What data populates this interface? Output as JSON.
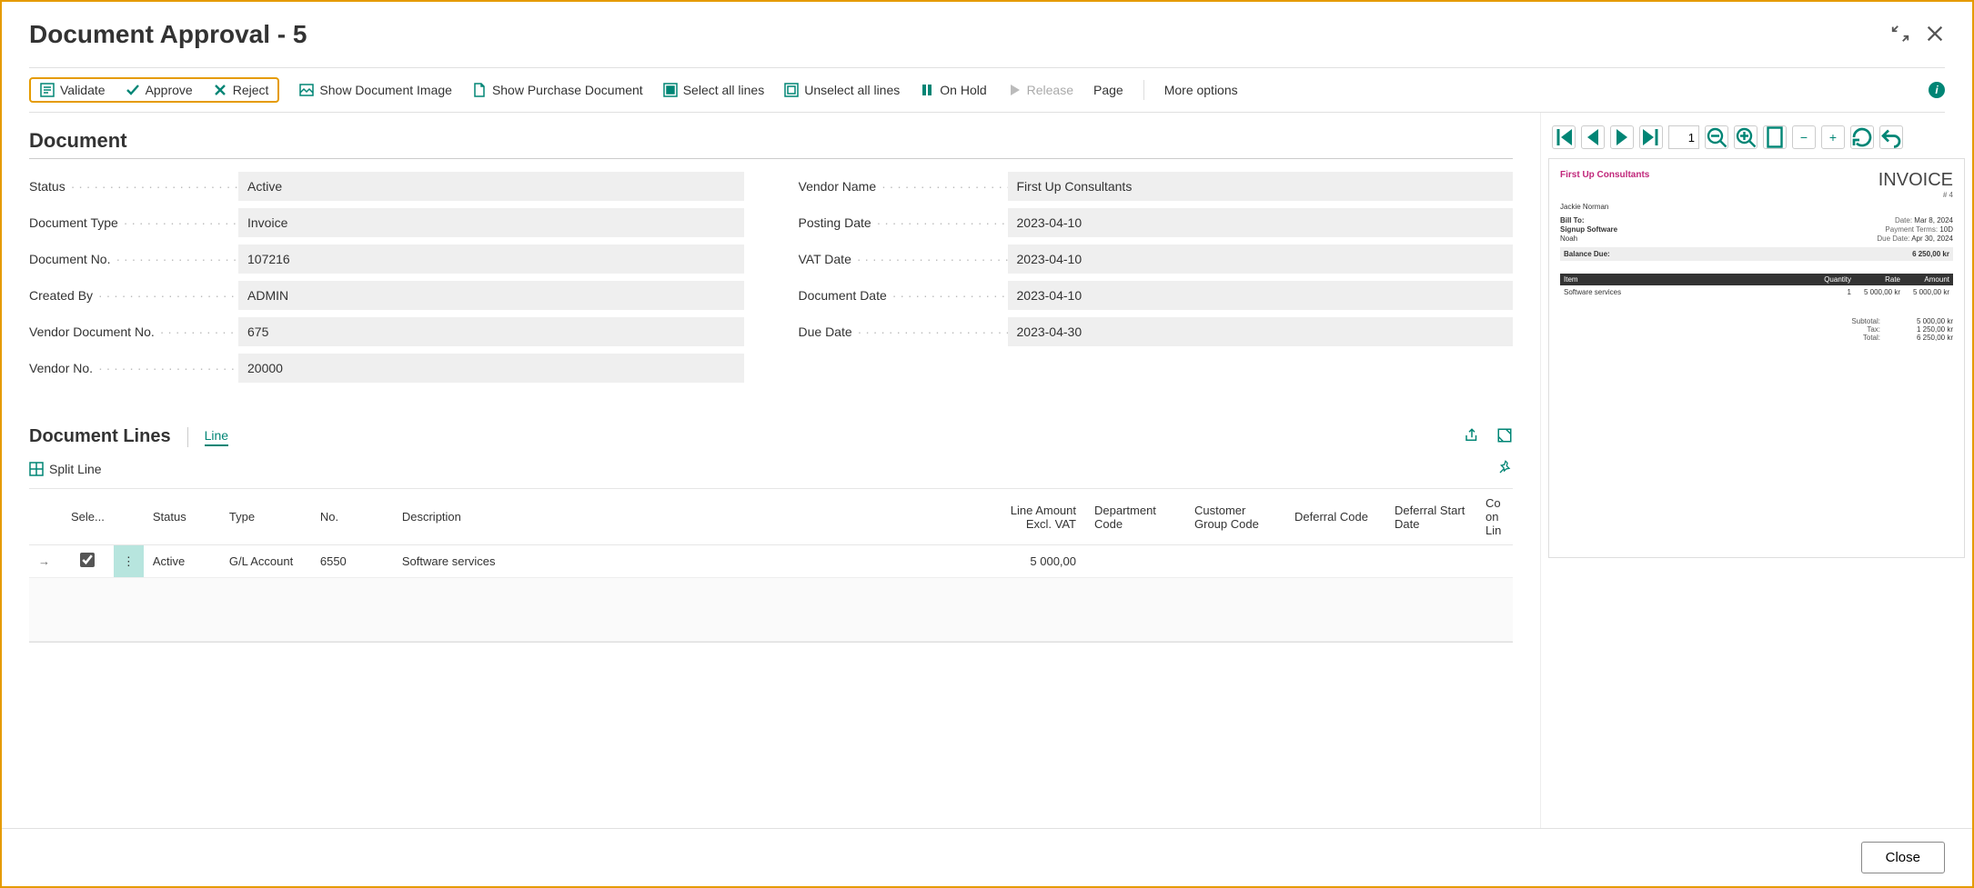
{
  "window": {
    "title": "Document Approval - 5"
  },
  "toolbar": {
    "validate": "Validate",
    "approve": "Approve",
    "reject": "Reject",
    "show_image": "Show Document Image",
    "show_purchase": "Show Purchase Document",
    "select_all": "Select all lines",
    "unselect_all": "Unselect all lines",
    "on_hold": "On Hold",
    "release": "Release",
    "page": "Page",
    "more": "More options"
  },
  "document": {
    "section_title": "Document",
    "left": [
      {
        "label": "Status",
        "value": "Active"
      },
      {
        "label": "Document Type",
        "value": "Invoice"
      },
      {
        "label": "Document No.",
        "value": "107216"
      },
      {
        "label": "Created By",
        "value": "ADMIN"
      },
      {
        "label": "Vendor Document No.",
        "value": "675"
      },
      {
        "label": "Vendor No.",
        "value": "20000"
      }
    ],
    "right": [
      {
        "label": "Vendor Name",
        "value": "First Up Consultants"
      },
      {
        "label": "Posting Date",
        "value": "2023-04-10"
      },
      {
        "label": "VAT Date",
        "value": "2023-04-10"
      },
      {
        "label": "Document Date",
        "value": "2023-04-10"
      },
      {
        "label": "Due Date",
        "value": "2023-04-30"
      }
    ]
  },
  "lines": {
    "title": "Document Lines",
    "line_link": "Line",
    "split_line": "Split Line",
    "columns": {
      "sele": "Sele...",
      "status": "Status",
      "type": "Type",
      "no": "No.",
      "description": "Description",
      "amount": "Line Amount Excl. VAT",
      "dept": "Department Code",
      "cust": "Customer Group Code",
      "deferral": "Deferral Code",
      "deferral_start": "Deferral Start Date",
      "comment": "Co on Lin"
    },
    "rows": [
      {
        "selected": true,
        "status": "Active",
        "type": "G/L Account",
        "no": "6550",
        "description": "Software services",
        "amount": "5 000,00",
        "dept": "",
        "cust": "",
        "deferral": "",
        "deferral_start": "",
        "comment": ""
      }
    ]
  },
  "pdf_toolbar": {
    "page_num": "1"
  },
  "invoice_preview": {
    "vendor": "First Up Consultants",
    "title": "INVOICE",
    "number": "# 4",
    "contact": "Jackie Norman",
    "billto_label": "Bill To:",
    "billto_name": "Signup Software",
    "billto_person": "Noah",
    "date_label": "Date:",
    "date": "Mar 8, 2024",
    "terms_label": "Payment Terms:",
    "terms": "10D",
    "due_label": "Due Date:",
    "due": "Apr 30, 2024",
    "balance_label": "Balance Due:",
    "balance": "6 250,00 kr",
    "head_item": "Item",
    "head_qty": "Quantity",
    "head_rate": "Rate",
    "head_amount": "Amount",
    "item_desc": "Software services",
    "item_qty": "1",
    "item_rate": "5 000,00 kr",
    "item_amount": "5 000,00 kr",
    "subtotal_label": "Subtotal:",
    "subtotal": "5 000,00 kr",
    "tax_label": "Tax:",
    "tax": "1 250,00 kr",
    "total_label": "Total:",
    "total": "6 250,00 kr"
  },
  "footer": {
    "close": "Close"
  }
}
